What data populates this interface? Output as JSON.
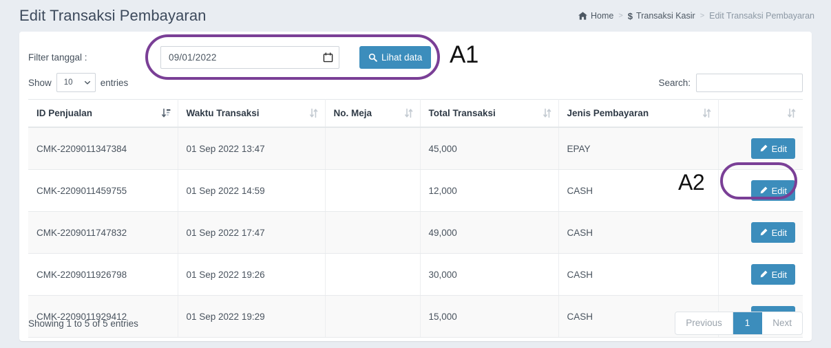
{
  "header": {
    "title": "Edit Transaksi Pembayaran",
    "breadcrumb": {
      "home": "Home",
      "section": "Transaksi Kasir",
      "current": "Edit Transaksi Pembayaran",
      "separator": ">"
    }
  },
  "filter": {
    "label": "Filter tanggal :",
    "date_value": "09/01/2022",
    "button_label": "Lihat data"
  },
  "controls": {
    "show_label": "Show",
    "entries_label": "entries",
    "page_length": "10",
    "search_label": "Search:",
    "search_value": "",
    "search_placeholder": ""
  },
  "table": {
    "columns": [
      "ID Penjualan",
      "Waktu Transaksi",
      "No. Meja",
      "Total Transaksi",
      "Jenis Pembayaran",
      ""
    ],
    "rows": [
      {
        "id": "CMK-2209011347384",
        "waktu": "01 Sep 2022 13:47",
        "meja": "",
        "total": "45,000",
        "jenis": "EPAY",
        "action": "Edit"
      },
      {
        "id": "CMK-2209011459755",
        "waktu": "01 Sep 2022 14:59",
        "meja": "",
        "total": "12,000",
        "jenis": "CASH",
        "action": "Edit"
      },
      {
        "id": "CMK-2209011747832",
        "waktu": "01 Sep 2022 17:47",
        "meja": "",
        "total": "49,000",
        "jenis": "CASH",
        "action": "Edit"
      },
      {
        "id": "CMK-2209011926798",
        "waktu": "01 Sep 2022 19:26",
        "meja": "",
        "total": "30,000",
        "jenis": "CASH",
        "action": "Edit"
      },
      {
        "id": "CMK-2209011929412",
        "waktu": "01 Sep 2022 19:29",
        "meja": "",
        "total": "15,000",
        "jenis": "CASH",
        "action": "Edit"
      }
    ]
  },
  "footer": {
    "info": "Showing 1 to 5 of 5 entries",
    "pagination": {
      "previous": "Previous",
      "page": "1",
      "next": "Next"
    }
  },
  "annotations": [
    {
      "id": "A1",
      "label": "A1"
    },
    {
      "id": "A2",
      "label": "A2"
    }
  ],
  "colors": {
    "accent_blue": "#3c8dbc",
    "annotation_purple": "#7a3f96",
    "page_background": "#e9edf2",
    "card_background": "#ffffff"
  }
}
